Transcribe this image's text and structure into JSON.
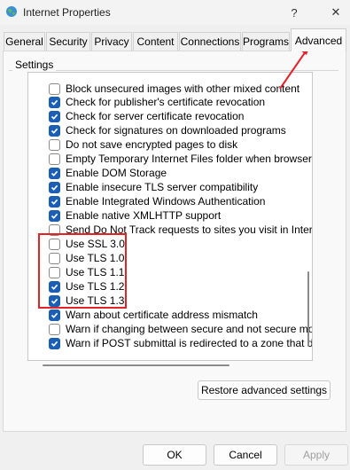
{
  "window": {
    "title": "Internet Properties"
  },
  "tabs": [
    "General",
    "Security",
    "Privacy",
    "Content",
    "Connections",
    "Programs",
    "Advanced"
  ],
  "active_tab": "Advanced",
  "settings_label": "Settings",
  "items": [
    {
      "label": "Block unsecured images with other mixed content",
      "checked": false
    },
    {
      "label": "Check for publisher's certificate revocation",
      "checked": true
    },
    {
      "label": "Check for server certificate revocation",
      "checked": true
    },
    {
      "label": "Check for signatures on downloaded programs",
      "checked": true
    },
    {
      "label": "Do not save encrypted pages to disk",
      "checked": false
    },
    {
      "label": "Empty Temporary Internet Files folder when browser is closed",
      "checked": false
    },
    {
      "label": "Enable DOM Storage",
      "checked": true
    },
    {
      "label": "Enable insecure TLS server compatibility",
      "checked": true
    },
    {
      "label": "Enable Integrated Windows Authentication",
      "checked": true
    },
    {
      "label": "Enable native XMLHTTP support",
      "checked": true
    },
    {
      "label": "Send Do Not Track requests to sites you visit in Internet Explorer",
      "checked": false
    },
    {
      "label": "Use SSL 3.0",
      "checked": false
    },
    {
      "label": "Use TLS 1.0",
      "checked": false
    },
    {
      "label": "Use TLS 1.1",
      "checked": false
    },
    {
      "label": "Use TLS 1.2",
      "checked": true
    },
    {
      "label": "Use TLS 1.3",
      "checked": true
    },
    {
      "label": "Warn about certificate address mismatch",
      "checked": true
    },
    {
      "label": "Warn if changing between secure and not secure mode",
      "checked": false
    },
    {
      "label": "Warn if POST submittal is redirected to a zone that does not permit posts",
      "checked": true
    }
  ],
  "buttons": {
    "restore": "Restore advanced settings",
    "ok": "OK",
    "cancel": "Cancel",
    "apply": "Apply"
  },
  "title_buttons": {
    "help": "?",
    "close": "✕"
  },
  "colors": {
    "accent": "#1a5fb4",
    "annotation": "#e0242a"
  }
}
